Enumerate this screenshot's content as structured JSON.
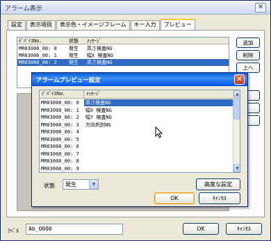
{
  "window": {
    "title": "アラーム表示",
    "close_glyph": "✕"
  },
  "tabs": [
    {
      "label": "設定"
    },
    {
      "label": "表示項目"
    },
    {
      "label": "表示色・イメージフレーム"
    },
    {
      "label": "キー入力"
    },
    {
      "label": "プレビュー"
    }
  ],
  "main_list": {
    "headers": [
      "ﾃﾞﾊﾞｲｽNo.",
      "状態",
      "ﾒｯｾｰｼﾞ"
    ],
    "rows": [
      {
        "device": "MR03000_00: 0",
        "status": "発生",
        "message": "高さ検査NG",
        "selected": false
      },
      {
        "device": "MR03000_00: 1",
        "status": "発生",
        "message": "幅X 検査NG",
        "selected": false
      },
      {
        "device": "MR03000_00: 2",
        "status": "発生",
        "message": "高さ検査NG",
        "selected": true
      }
    ]
  },
  "side_buttons": {
    "add": "追加",
    "delete": "削除",
    "up": "上へ"
  },
  "dialog": {
    "title": "アラームプレビュー設定",
    "headers": [
      "ﾃﾞﾊﾞｲｽNo.",
      "ﾒｯｾｰｼﾞ"
    ],
    "rows": [
      {
        "device": "MR03000_00: 0",
        "message": "高さ検査NG",
        "selected": true
      },
      {
        "device": "MR03000_00: 1",
        "message": "幅X 検査NG",
        "selected": false
      },
      {
        "device": "MR03000_00: 2",
        "message": "幅Y 検査NG",
        "selected": false
      },
      {
        "device": "MR03000_00: 3",
        "message": "方向判別NG",
        "selected": false
      },
      {
        "device": "MR03000_00: 4",
        "message": "",
        "selected": false
      },
      {
        "device": "MR03000_00: 5",
        "message": "",
        "selected": false
      },
      {
        "device": "MR03000_00: 6",
        "message": "",
        "selected": false
      },
      {
        "device": "MR03000_00: 7",
        "message": "",
        "selected": false
      },
      {
        "device": "MR03000_00: 8",
        "message": "",
        "selected": false
      },
      {
        "device": "MR03000_00: 9",
        "message": "",
        "selected": false
      }
    ],
    "status_label": "状態",
    "status_value": "発生",
    "advanced_button": "高度な設定",
    "ok_button": "OK",
    "cancel_button": "ｷｬﾝｾﾙ"
  },
  "bottom": {
    "label": "ﾗﾍﾞﾙ",
    "label_value": "Ab_0000",
    "ok_button": "OK",
    "cancel_button": "ｷｬﾝｾﾙ"
  },
  "colors": {
    "selection": "#316ac5",
    "dialog_title": "#0054e3",
    "panel_gray": "#c6c3bb"
  }
}
